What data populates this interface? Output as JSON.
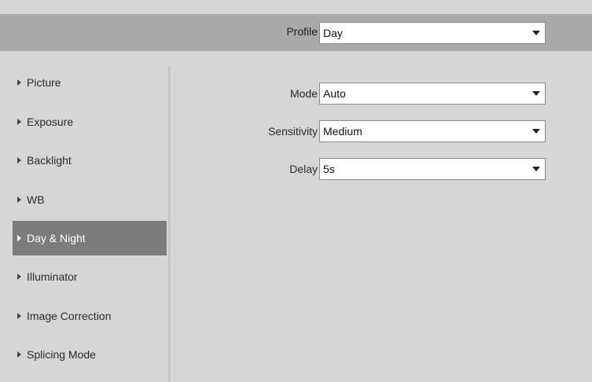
{
  "profile": {
    "label": "Profile",
    "value": "Day"
  },
  "menu": {
    "items": [
      {
        "label": "Picture",
        "active": false
      },
      {
        "label": "Exposure",
        "active": false
      },
      {
        "label": "Backlight",
        "active": false
      },
      {
        "label": "WB",
        "active": false
      },
      {
        "label": "Day & Night",
        "active": true
      },
      {
        "label": "Illuminator",
        "active": false
      },
      {
        "label": "Image Correction",
        "active": false
      },
      {
        "label": "Splicing Mode",
        "active": false
      }
    ]
  },
  "form": {
    "mode": {
      "label": "Mode",
      "value": "Auto"
    },
    "sensitivity": {
      "label": "Sensitivity",
      "value": "Medium"
    },
    "delay": {
      "label": "Delay",
      "value": "5s"
    }
  },
  "colors": {
    "background": "#d6d6d6",
    "header_bar": "#a9a9a9",
    "active_menu": "#7c7c7c"
  },
  "icons": {
    "dropdown": "chevron-down-icon",
    "menu_bullet": "triangle-right-icon"
  }
}
